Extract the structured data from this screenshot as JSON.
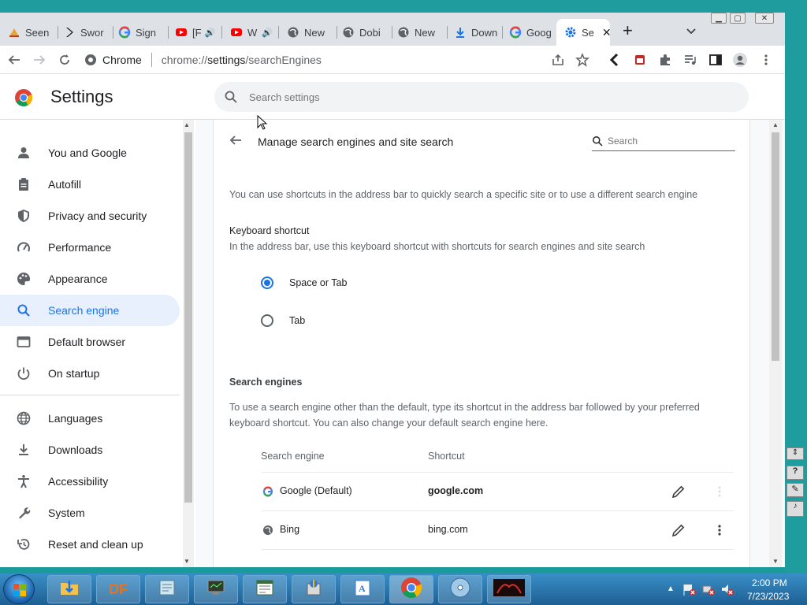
{
  "tabs": [
    {
      "label": "Seen",
      "icon": "seenit-icon"
    },
    {
      "label": "Swor",
      "icon": "sword-icon"
    },
    {
      "label": "Sign",
      "icon": "google-icon"
    },
    {
      "label": "[F",
      "icon": "youtube-icon"
    },
    {
      "label": "W",
      "icon": "youtube-icon"
    },
    {
      "label": "New",
      "icon": "globe-icon"
    },
    {
      "label": "Dobi",
      "icon": "globe-icon"
    },
    {
      "label": "New",
      "icon": "globe-icon"
    },
    {
      "label": "Down",
      "icon": "download-icon"
    },
    {
      "label": "Goog",
      "icon": "google-icon"
    },
    {
      "label": "Se",
      "icon": "settings-gear-icon"
    }
  ],
  "toolbar": {
    "site_label": "Chrome",
    "url_prefix": "chrome://",
    "url_host": "settings",
    "url_path": "/searchEngines"
  },
  "header": {
    "title": "Settings",
    "search_placeholder": "Search settings"
  },
  "sidebar": {
    "items": [
      {
        "label": "You and Google",
        "icon": "person-icon"
      },
      {
        "label": "Autofill",
        "icon": "clipboard-icon"
      },
      {
        "label": "Privacy and security",
        "icon": "shield-icon"
      },
      {
        "label": "Performance",
        "icon": "speedometer-icon"
      },
      {
        "label": "Appearance",
        "icon": "palette-icon"
      },
      {
        "label": "Search engine",
        "icon": "search-icon"
      },
      {
        "label": "Default browser",
        "icon": "browser-icon"
      },
      {
        "label": "On startup",
        "icon": "power-icon"
      },
      {
        "label": "Languages",
        "icon": "globe-icon"
      },
      {
        "label": "Downloads",
        "icon": "download-icon"
      },
      {
        "label": "Accessibility",
        "icon": "accessibility-icon"
      },
      {
        "label": "System",
        "icon": "wrench-icon"
      },
      {
        "label": "Reset and clean up",
        "icon": "history-icon"
      }
    ],
    "active_index": 5
  },
  "main": {
    "page_title": "Manage search engines and site search",
    "search_placeholder": "Search",
    "intro": "You can use shortcuts in the address bar to quickly search a specific site or to use a different search engine",
    "keyboard_heading": "Keyboard shortcut",
    "keyboard_desc": "In the address bar, use this keyboard shortcut with shortcuts for search engines and site search",
    "radio_options": [
      {
        "label": "Space or Tab",
        "checked": true
      },
      {
        "label": "Tab",
        "checked": false
      }
    ],
    "engines_heading": "Search engines",
    "engines_desc_1": "To use a search engine other than the default, type its shortcut in the address bar followed by your preferred",
    "engines_desc_2": "keyboard shortcut. You can also change your default search engine here.",
    "columns": [
      "Search engine",
      "Shortcut"
    ],
    "engines": [
      {
        "name": "Google (Default)",
        "shortcut": "google.com",
        "icon": "google-icon"
      },
      {
        "name": "Bing",
        "shortcut": "bing.com",
        "icon": "globe-icon"
      }
    ]
  },
  "taskbar": {
    "apps": [
      {
        "label": "",
        "icon": "folder-icon"
      },
      {
        "label": "DF",
        "icon": "df-icon"
      },
      {
        "label": "",
        "icon": "notepad-icon"
      },
      {
        "label": "",
        "icon": "monitor-icon"
      },
      {
        "label": "",
        "icon": "document-icon"
      },
      {
        "label": "",
        "icon": "installer-icon"
      },
      {
        "label": "",
        "icon": "wordpad-icon"
      },
      {
        "label": "",
        "icon": "chrome-icon"
      },
      {
        "label": "",
        "icon": "media-icon"
      },
      {
        "label": "",
        "icon": "game-icon"
      }
    ],
    "time": "2:00 PM",
    "date": "7/23/2023"
  },
  "colors": {
    "accent": "#1a73e8",
    "active_nav_bg": "#e8f0fe"
  }
}
